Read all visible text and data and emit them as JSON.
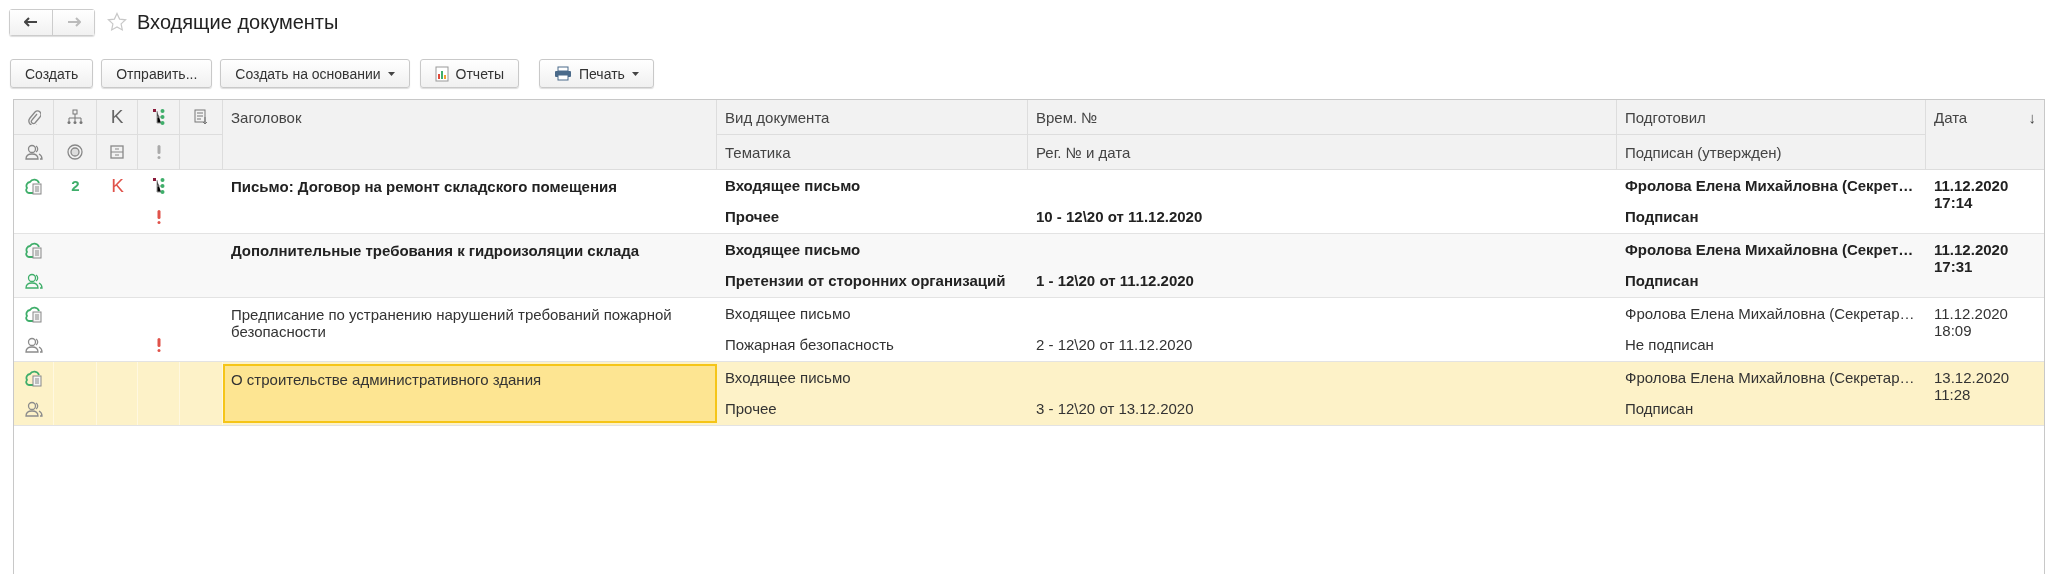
{
  "nav": [
    {
      "kind": "back",
      "disabled": false
    },
    {
      "kind": "forward",
      "disabled": true
    }
  ],
  "favorite": false,
  "title": "Входящие документы",
  "toolbar": [
    {
      "label": "Создать",
      "kind": "plain",
      "dropdown": false
    },
    {
      "label": "Отправить...",
      "kind": "plain",
      "dropdown": false
    },
    {
      "label": "Создать на основании",
      "kind": "plain",
      "dropdown": true
    },
    {
      "label": "Отчеты",
      "kind": "report",
      "dropdown": false
    },
    {
      "label": "Печать",
      "kind": "print",
      "dropdown": true
    }
  ],
  "header": {
    "mark": "K",
    "title": "Заголовок",
    "doc_type": "Вид документа",
    "topic": "Тематика",
    "temp_no": "Врем. №",
    "reg_no": "Рег. № и дата",
    "prepared_by": "Подготовил",
    "signed": "Подписан (утвержден)",
    "date": "Дата",
    "sort_arrow": "↓"
  },
  "rows": [
    {
      "bold": true,
      "selected": false,
      "approvers_shown": false,
      "count": "2",
      "mark": "K",
      "subtasks": true,
      "important": true,
      "title": "Письмо: Договор на ремонт складского помещения",
      "doc_type": "Входящее письмо",
      "topic": "Прочее",
      "reg_no": "10 - 12\\20 от 11.12.2020",
      "prepared_by": "Фролова Елена Михайловна (Секрет…",
      "signed": "Подписан",
      "date": "11.12.2020",
      "time": "17:14"
    },
    {
      "bold": true,
      "selected": false,
      "approvers_shown": true,
      "approvers_active": true,
      "important": false,
      "subtasks": false,
      "title": "Дополнительные требования к гидроизоляции склада",
      "doc_type": "Входящее письмо",
      "topic": "Претензии от сторонних организаций",
      "reg_no": "1 - 12\\20 от 11.12.2020",
      "prepared_by": "Фролова Елена Михайловна (Секрет…",
      "signed": "Подписан",
      "date": "11.12.2020",
      "time": "17:31"
    },
    {
      "bold": false,
      "selected": false,
      "approvers_shown": true,
      "approvers_active": false,
      "important": true,
      "subtasks": false,
      "title": "Предписание по устранению нарушений требований пожарной безопасности",
      "doc_type": "Входящее письмо",
      "topic": "Пожарная безопасность",
      "reg_no": "2 - 12\\20 от 11.12.2020",
      "prepared_by": "Фролова Елена Михайловна (Секретар…",
      "signed": "Не подписан",
      "date": "11.12.2020",
      "time": "18:09"
    },
    {
      "bold": false,
      "selected": true,
      "approvers_shown": true,
      "approvers_active": false,
      "important": false,
      "subtasks": false,
      "title": "О строительстве административного здания",
      "doc_type": "Входящее письмо",
      "topic": "Прочее",
      "reg_no": "3 - 12\\20 от 13.12.2020",
      "prepared_by": "Фролова Елена Михайловна (Секретар…",
      "signed": "Подписан",
      "date": "13.12.2020",
      "time": "11:28"
    }
  ]
}
